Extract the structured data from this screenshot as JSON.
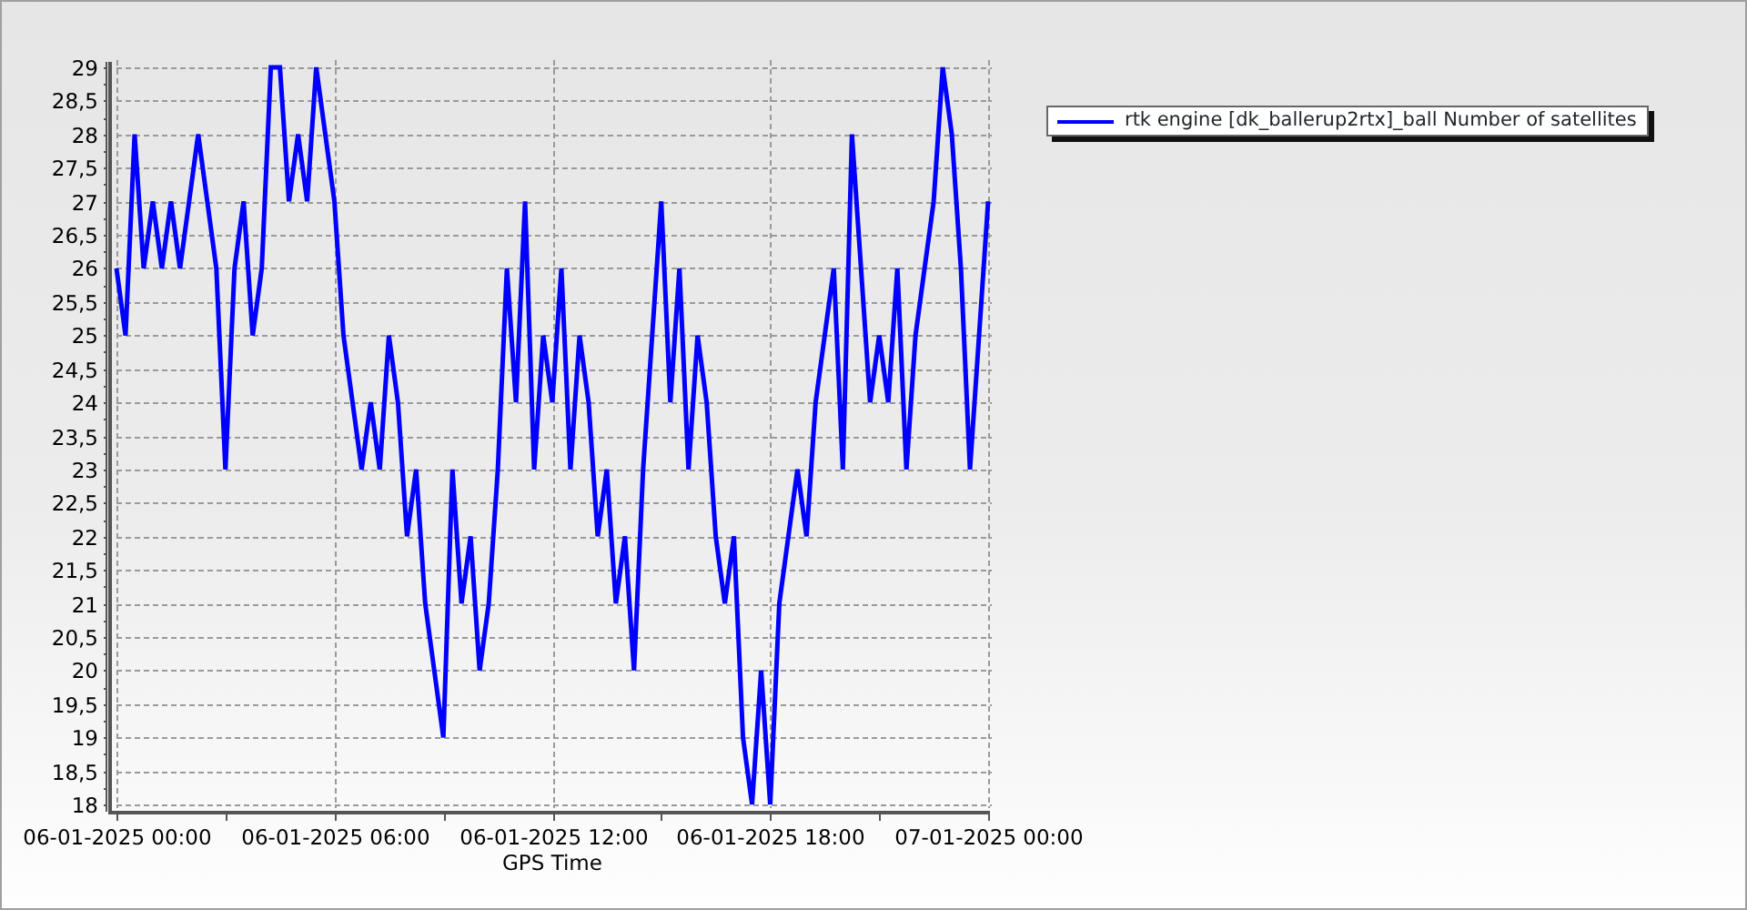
{
  "chart": {
    "chart_data": {
      "type": "line",
      "xlabel": "GPS Time",
      "categories": [
        "06-01-2025 00:00",
        null,
        null,
        null,
        null,
        null,
        null,
        null,
        null,
        null,
        null,
        null,
        null,
        null,
        null,
        null,
        null,
        null,
        null,
        null,
        null,
        null,
        null,
        null,
        "06-01-2025 06:00",
        null,
        null,
        null,
        null,
        null,
        null,
        null,
        null,
        null,
        null,
        null,
        null,
        null,
        null,
        null,
        null,
        null,
        null,
        null,
        null,
        null,
        null,
        null,
        "06-01-2025 12:00",
        null,
        null,
        null,
        null,
        null,
        null,
        null,
        null,
        null,
        null,
        null,
        null,
        null,
        null,
        null,
        null,
        null,
        null,
        null,
        null,
        null,
        null,
        null,
        "06-01-2025 18:00",
        null,
        null,
        null,
        null,
        null,
        null,
        null,
        null,
        null,
        null,
        null,
        null,
        null,
        null,
        null,
        null,
        null,
        null,
        null,
        null,
        null,
        null,
        null,
        "07-01-2025 00:00"
      ],
      "series": [
        {
          "name": "rtk engine [dk_ballerup2rtx]_ball Number of satellites",
          "color": "#0000ff",
          "values": [
            26,
            25,
            28,
            26,
            27,
            26,
            27,
            26,
            27,
            28,
            27,
            26,
            23,
            26,
            27,
            25,
            26,
            29,
            29,
            27,
            28,
            27,
            29,
            28,
            27,
            25,
            24,
            23,
            24,
            23,
            25,
            24,
            22,
            23,
            21,
            20,
            19,
            23,
            21,
            22,
            20,
            21,
            23,
            26,
            24,
            27,
            23,
            25,
            24,
            26,
            23,
            25,
            24,
            22,
            23,
            21,
            22,
            20,
            23,
            25,
            27,
            24,
            26,
            23,
            25,
            24,
            22,
            21,
            22,
            19,
            18,
            20,
            18,
            21,
            22,
            23,
            22,
            24,
            25,
            26,
            23,
            28,
            26,
            24,
            25,
            24,
            26,
            23,
            25,
            26,
            27,
            29,
            28,
            26,
            23,
            25,
            27
          ]
        }
      ],
      "grid": true,
      "ylim": [
        18,
        29
      ],
      "yticks": [
        {
          "value": 18,
          "label": "18"
        },
        {
          "value": 18.5,
          "label": "18,5"
        },
        {
          "value": 19,
          "label": "19"
        },
        {
          "value": 19.5,
          "label": "19,5"
        },
        {
          "value": 20,
          "label": "20"
        },
        {
          "value": 20.5,
          "label": "20,5"
        },
        {
          "value": 21,
          "label": "21"
        },
        {
          "value": 21.5,
          "label": "21,5"
        },
        {
          "value": 22,
          "label": "22"
        },
        {
          "value": 22.5,
          "label": "22,5"
        },
        {
          "value": 23,
          "label": "23"
        },
        {
          "value": 23.5,
          "label": "23,5"
        },
        {
          "value": 24,
          "label": "24"
        },
        {
          "value": 24.5,
          "label": "24,5"
        },
        {
          "value": 25,
          "label": "25"
        },
        {
          "value": 25.5,
          "label": "25,5"
        },
        {
          "value": 26,
          "label": "26"
        },
        {
          "value": 26.5,
          "label": "26,5"
        },
        {
          "value": 27,
          "label": "27"
        },
        {
          "value": 27.5,
          "label": "27,5"
        },
        {
          "value": 28,
          "label": "28"
        },
        {
          "value": 28.5,
          "label": "28,5"
        },
        {
          "value": 29,
          "label": "29"
        }
      ]
    }
  }
}
